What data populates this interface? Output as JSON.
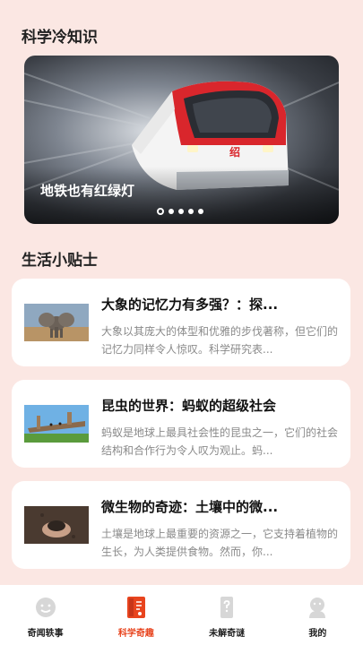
{
  "sections": {
    "trivia_title": "科学冷知识",
    "tips_title": "生活小贴士"
  },
  "banner": {
    "caption": "地铁也有红绿灯",
    "train_mark": "绍",
    "dots_count": 5,
    "active_dot": 0
  },
  "cards": [
    {
      "title": "大象的记忆力有多强？：探...",
      "desc": "大象以其庞大的体型和优雅的步伐著称，但它们的记忆力同样令人惊叹。科学研究表...",
      "thumb": "elephant"
    },
    {
      "title": "昆虫的世界：蚂蚁的超级社会",
      "desc": "蚂蚁是地球上最具社会性的昆虫之一，它们的社会结构和合作行为令人叹为观止。蚂...",
      "thumb": "ants-on-log"
    },
    {
      "title": "微生物的奇迹：土壤中的微...",
      "desc": "土壤是地球上最重要的资源之一，它支持着植物的生长，为人类提供食物。然而，你...",
      "thumb": "soil-hands"
    }
  ],
  "tabbar": {
    "tabs": [
      {
        "label": "奇闻轶事",
        "icon": "smile-face-icon"
      },
      {
        "label": "科学奇趣",
        "icon": "science-book-icon"
      },
      {
        "label": "未解奇谜",
        "icon": "question-phone-icon"
      },
      {
        "label": "我的",
        "icon": "user-icon"
      }
    ],
    "active_index": 1,
    "active_color": "#e8441e"
  }
}
